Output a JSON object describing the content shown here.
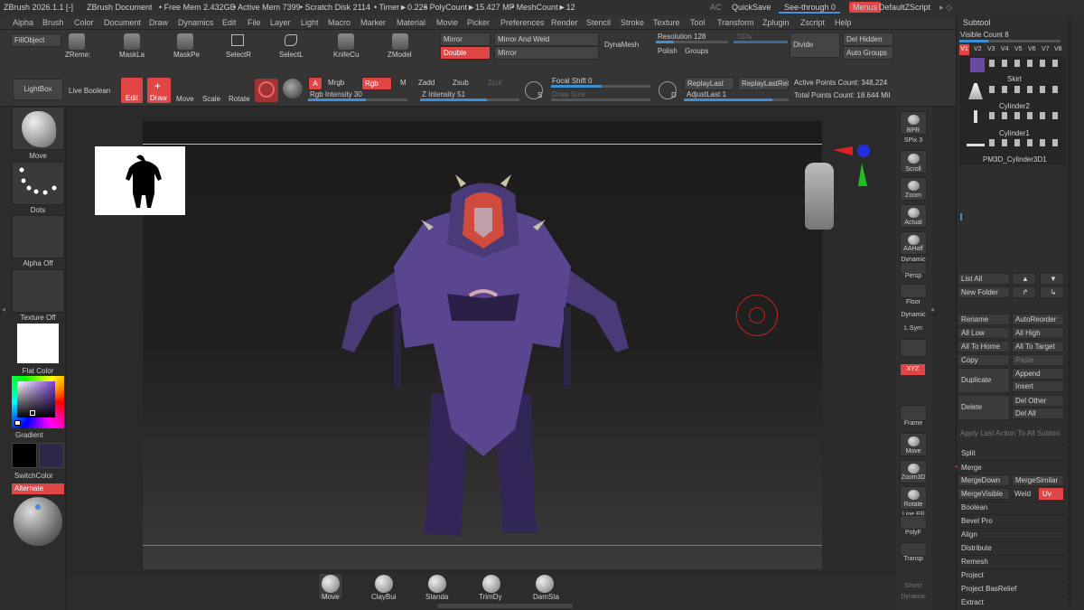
{
  "titlebar": {
    "app": "ZBrush 2026.1.1 [-]",
    "document": "ZBrush Document",
    "free_mem": "• Free Mem 2.432GB",
    "active_mem": "• Active Mem 7399",
    "scratch": "• Scratch Disk 2114",
    "timer": "• Timer►0.226",
    "polycount": "• PolyCount►15.427 MP",
    "meshcount": "• MeshCount►12",
    "ac": "AC",
    "quicksave": "QuickSave",
    "seethrough": "See-through",
    "seethrough_val": "0",
    "menus": "Menus",
    "script": "DefaultZScript"
  },
  "menu": [
    "Alpha",
    "Brush",
    "Color",
    "Document",
    "Draw",
    "Dynamics",
    "Edit",
    "File",
    "Layer",
    "Light",
    "Macro",
    "Marker",
    "Material",
    "Movie",
    "Picker",
    "Preferences",
    "Render",
    "Stencil",
    "Stroke",
    "Texture",
    "Tool",
    "Transform",
    "Zplugin",
    "Zscript",
    "Help"
  ],
  "toolbar1": {
    "fillobject": "FillObject",
    "zremesher": "ZReme:",
    "masklasso": "MaskLa",
    "maskpen": "MaskPe",
    "selectrect": "SelectR",
    "selectlasso": "SelectL",
    "knifecurve": "KnifeCu",
    "zmodeler": "ZModel",
    "mirror": "Mirror",
    "mirror_weld": "Mirror And Weld",
    "double": "Double",
    "mirror2": "Mirror",
    "dynamesh": "DynaMesh",
    "resolution": "Resolution 128",
    "sdiv": "SDiv",
    "polish": "Polish",
    "groups": "Groups",
    "divide": "Divide",
    "del_hidden": "Del Hidden",
    "auto_groups": "Auto Groups"
  },
  "toolbar2": {
    "lightbox": "LightBox",
    "live_boolean": "Live Boolean",
    "edit": "Edit",
    "draw": "Draw",
    "move": "Move",
    "scale": "Scale",
    "rotate": "Rotate",
    "a": "A",
    "mrgb": "Mrgb",
    "rgb": "Rgb",
    "m": "M",
    "zadd": "Zadd",
    "zsub": "Zsub",
    "zcut": "Zcut",
    "rgb_intensity": "Rgb Intensity 30",
    "z_intensity": "Z Intensity 51",
    "focal_shift": "Focal Shift 0",
    "draw_size": "Draw Size",
    "s": "S",
    "d": "D",
    "replay_last": "ReplayLast",
    "replay_last_rel": "ReplayLastRel",
    "adjust_last": "AdjustLast 1",
    "active_points": "Active Points Count: 348,224",
    "total_points": "Total Points Count: 18.644 Mil"
  },
  "leftshelf": {
    "move": "Move",
    "dots": "Dots",
    "alpha": "Alpha Off",
    "texture": "Texture Off",
    "material": "Flat Color",
    "gradient": "Gradient",
    "switchcolor": "SwitchColor",
    "alternate": "Alternate"
  },
  "rightshelf": [
    "BPR",
    "SPix 3",
    "Scroll",
    "Zoom",
    "Actual",
    "AAHalf",
    "Dynamic",
    "Persp",
    "Floor",
    "Dynamic",
    "L.Sym",
    "XYZ",
    "Frame",
    "Move",
    "Zoom3D",
    "Rotate",
    "Line Fill",
    "PolyF",
    "Transp",
    "Ghost",
    "Dynamic"
  ],
  "bottomshelf": [
    "Move",
    "ClayBui",
    "Standa",
    "TrimDy",
    "DamSta"
  ],
  "subtool": {
    "title": "Subtool",
    "visible_count": "Visible Count 8",
    "versions": [
      "V1",
      "V2",
      "V3",
      "V4",
      "V5",
      "V6",
      "V7",
      "V8"
    ],
    "items": [
      "Skirt",
      "Cylinder2",
      "Cylinder1",
      "PM3D_Cylinder3D1"
    ],
    "list_all": "List All",
    "new_folder": "New Folder",
    "rename": "Rename",
    "auto_reorder": "AutoReorder",
    "all_low": "All Low",
    "all_high": "All High",
    "all_to_home": "All To Home",
    "all_to_target": "All To Target",
    "copy": "Copy",
    "paste": "Paste",
    "duplicate": "Duplicate",
    "append": "Append",
    "insert": "Insert",
    "delete": "Delete",
    "del_other": "Del Other",
    "del_all": "Del All",
    "apply_last": "Apply Last Action To All Subtoo",
    "split": "Split",
    "merge": "Merge",
    "merge_down": "MergeDown",
    "merge_similar": "MergeSimilar",
    "merge_visible": "MergeVisible",
    "weld": "Weld",
    "uv": "Uv",
    "sections": [
      "Boolean",
      "Bevel Pro",
      "Align",
      "Distribute",
      "Remesh",
      "Project",
      "Project BasRelief",
      "Extract"
    ]
  },
  "colors": {
    "accent_red": "#e04646",
    "accent_blue": "#3d8ed8",
    "character_purple": "#4a3a78",
    "hair_red": "#d04a3e"
  }
}
